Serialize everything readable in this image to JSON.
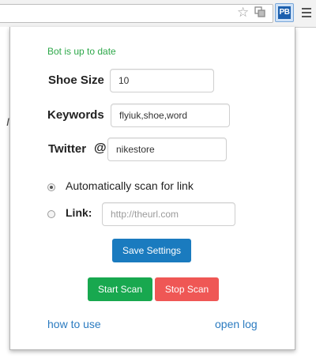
{
  "colors": {
    "status_green": "#2ea84a",
    "save_blue": "#1a7bbf",
    "start_green": "#18a84f",
    "stop_red": "#ef5755",
    "link_blue": "#2b7bc0"
  },
  "browser": {
    "extension_logo_text": "PB",
    "icons": [
      "star-icon",
      "extension-icon",
      "menu-icon"
    ]
  },
  "popup": {
    "status": "Bot is up to date",
    "shoe_size": {
      "label": "Shoe Size",
      "value": "10"
    },
    "keywords": {
      "label": "Keywords",
      "value": "flyiuk,shoe,word"
    },
    "twitter": {
      "label": "Twitter",
      "at": "@",
      "value": "nikestore"
    },
    "auto_scan": {
      "label": "Automatically scan for link",
      "checked": true
    },
    "link": {
      "label": "Link:",
      "placeholder": "http://theurl.com",
      "value": ""
    },
    "save_label": "Save Settings",
    "start_label": "Start Scan",
    "stop_label": "Stop Scan",
    "how_to_use": "how to use",
    "open_log": "open log"
  }
}
